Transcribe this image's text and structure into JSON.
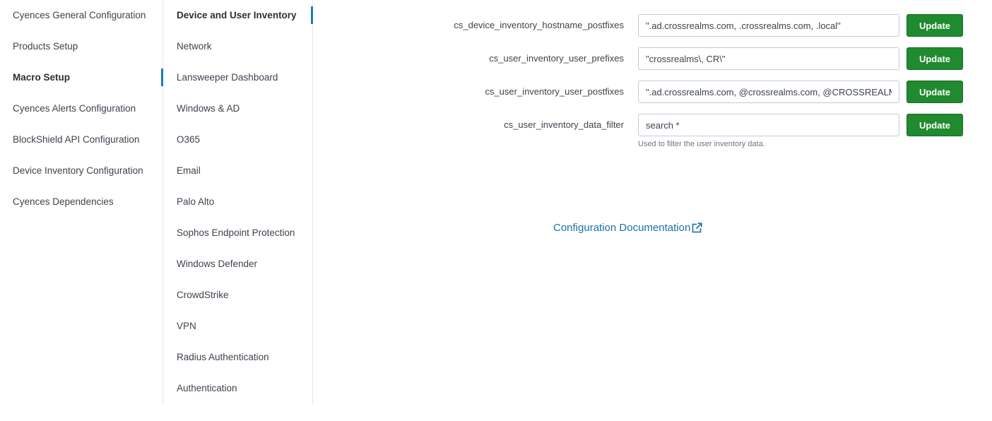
{
  "sidebar": {
    "items": [
      {
        "label": "Cyences General Configuration",
        "active": false
      },
      {
        "label": "Products Setup",
        "active": false
      },
      {
        "label": "Macro Setup",
        "active": true
      },
      {
        "label": "Cyences Alerts Configuration",
        "active": false
      },
      {
        "label": "BlockShield API Configuration",
        "active": false
      },
      {
        "label": "Device Inventory Configuration",
        "active": false
      },
      {
        "label": "Cyences Dependencies",
        "active": false
      }
    ]
  },
  "submenu": {
    "items": [
      {
        "label": "Device and User Inventory",
        "active": true
      },
      {
        "label": "Network",
        "active": false
      },
      {
        "label": "Lansweeper Dashboard",
        "active": false
      },
      {
        "label": "Windows & AD",
        "active": false
      },
      {
        "label": "O365",
        "active": false
      },
      {
        "label": "Email",
        "active": false
      },
      {
        "label": "Palo Alto",
        "active": false
      },
      {
        "label": "Sophos Endpoint Protection",
        "active": false
      },
      {
        "label": "Windows Defender",
        "active": false
      },
      {
        "label": "CrowdStrike",
        "active": false
      },
      {
        "label": "VPN",
        "active": false
      },
      {
        "label": "Radius Authentication",
        "active": false
      },
      {
        "label": "Authentication",
        "active": false
      }
    ]
  },
  "form": {
    "update_label": "Update",
    "fields": [
      {
        "label": "cs_device_inventory_hostname_postfixes",
        "value": "\".ad.crossrealms.com, .crossrealms.com, .local\""
      },
      {
        "label": "cs_user_inventory_user_prefixes",
        "value": "\"crossrealms\\, CR\\\""
      },
      {
        "label": "cs_user_inventory_user_postfixes",
        "value": "\".ad.crossrealms.com, @crossrealms.com, @CROSSREALMS.COM\""
      },
      {
        "label": "cs_user_inventory_data_filter",
        "value": "search *",
        "help": "Used to filter the user inventory data."
      }
    ]
  },
  "documentation_link": {
    "label": "Configuration Documentation",
    "icon": "external-link-icon"
  },
  "colors": {
    "accent": "#1a7fb8",
    "button_green": "#1f8a2e",
    "link": "#1a6fa8",
    "divider": "#e1e6eb"
  }
}
